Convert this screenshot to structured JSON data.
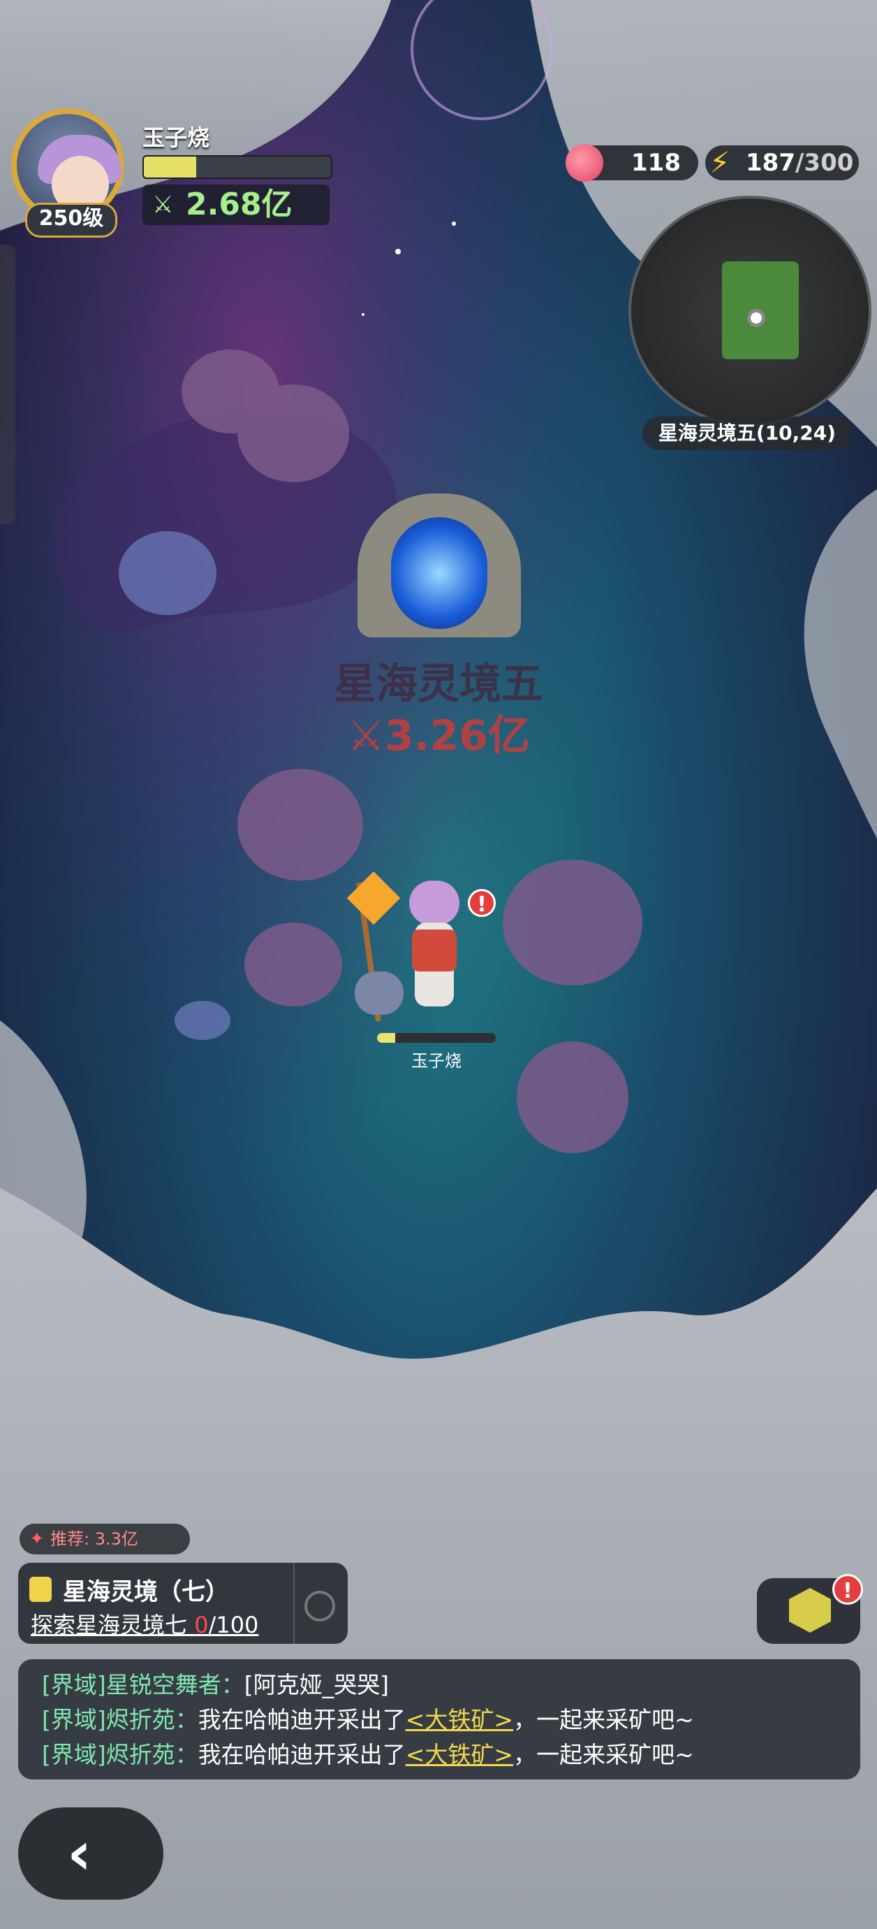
{
  "player": {
    "name": "玉子烧",
    "level": "250级",
    "exp_fraction": 0.28,
    "power": "2.68亿",
    "power_icon": "power-icon"
  },
  "resources": {
    "peach": "118",
    "energy_current": "187",
    "energy_max": "300",
    "energy_sep": "/"
  },
  "minimap": {
    "location": "星海灵境五(10,24)"
  },
  "portal": {
    "name": "星海灵境五",
    "power": "3.26亿"
  },
  "character": {
    "name": "玉子烧",
    "hp_fraction": 0.15,
    "alert": "!"
  },
  "quest": {
    "recommend": "推荐: 3.3亿",
    "title": "星海灵境（七）",
    "desc_prefix": "探索星海灵境七 ",
    "progress_current": "0",
    "progress_total": "/100"
  },
  "box": {
    "alert": "!"
  },
  "chat": [
    {
      "channel": "[界域]",
      "speaker": "星锐空舞者：",
      "text": "[阿克娅_哭哭]",
      "link": "",
      "suffix": ""
    },
    {
      "channel": "[界域]",
      "speaker": "烬折苑：",
      "text": "我在哈帕迪开采出了",
      "link": "<大铁矿>",
      "suffix": "，一起来采矿吧~"
    },
    {
      "channel": "[界域]",
      "speaker": "烬折苑：",
      "text": "我在哈帕迪开采出了",
      "link": "<大铁矿>",
      "suffix": "，一起来采矿吧~"
    }
  ],
  "back": {
    "icon": "chevron-left-icon"
  },
  "colors": {
    "power_green": "#a6f08c",
    "gold_frame": "#d9a93a",
    "alert_red": "#e43d3d",
    "chat_green": "#7fe7b0",
    "link_yellow": "#f2d84a"
  }
}
